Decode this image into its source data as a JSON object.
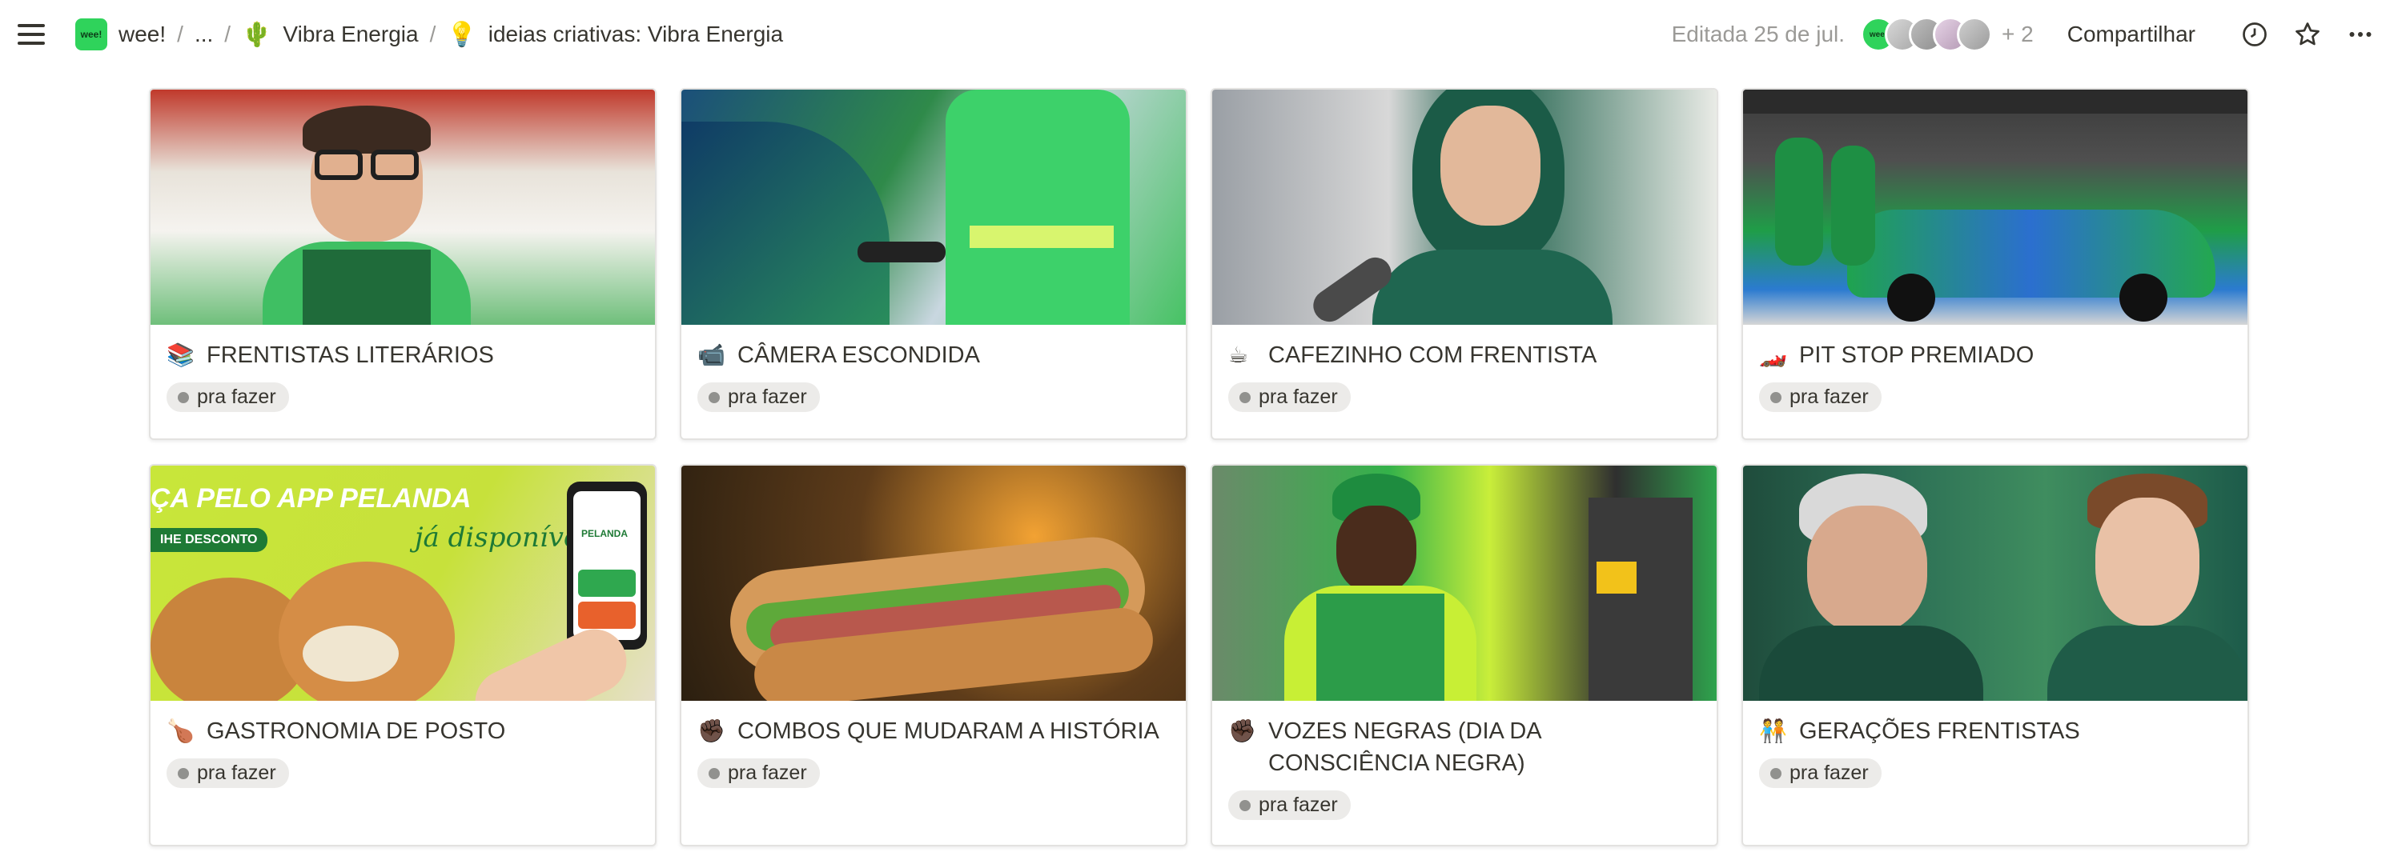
{
  "topbar": {
    "breadcrumbs": [
      {
        "label": "wee!",
        "icon": "wee-logo"
      },
      {
        "label": "...",
        "icon": ""
      },
      {
        "label": "Vibra Energia",
        "icon": "cactus-icon",
        "icon_glyph": "🌵"
      },
      {
        "label": "ideias criativas: Vibra Energia",
        "icon": "lightbulb-icon",
        "icon_glyph": "💡"
      }
    ],
    "separator": "/",
    "edited": "Editada 25 de jul.",
    "avatar_brand_text": "wee!",
    "extra_collaborators": "+ 2",
    "share_label": "Compartilhar"
  },
  "cards": [
    {
      "emoji": "📚",
      "title": "FRENTISTAS LITERÁRIOS",
      "status": "pra fazer",
      "cover": "photo-attendant-glasses"
    },
    {
      "emoji": "📹",
      "title": "CÂMERA ESCONDIDA",
      "status": "pra fazer",
      "cover": "photo-fueling-car"
    },
    {
      "emoji": "☕",
      "title": "CAFEZINHO COM FRENTISTA",
      "status": "pra fazer",
      "cover": "photo-interview-microphone"
    },
    {
      "emoji": "🏎️",
      "title": "PIT STOP PREMIADO",
      "status": "pra fazer",
      "cover": "photo-race-pit-stop"
    },
    {
      "emoji": "🍗",
      "title": "GASTRONOMIA DE POSTO",
      "status": "pra fazer",
      "cover": "ad-app-pelanda",
      "cover_text": [
        "ÇA PELO APP PELANDA",
        "já disponível!",
        "IHE DESCONTO",
        "PELANDA"
      ]
    },
    {
      "emoji": "✊🏿",
      "title": "COMBOS QUE MUDARAM A HISTÓRIA",
      "status": "pra fazer",
      "cover": "photo-sandwich"
    },
    {
      "emoji": "✊🏿",
      "title": "VOZES NEGRAS (DIA DA CONSCIÊNCIA NEGRA)",
      "status": "pra fazer",
      "cover": "photo-attendant-vest"
    },
    {
      "emoji": "🧑‍🤝‍🧑",
      "title": "GERAÇÕES FRENTISTAS",
      "status": "pra fazer",
      "cover": "photo-two-generations"
    }
  ],
  "colors": {
    "brand_green": "#2fd35b",
    "tag_bg": "#ecebe9",
    "text": "#37352f",
    "muted": "#9b9a97"
  }
}
